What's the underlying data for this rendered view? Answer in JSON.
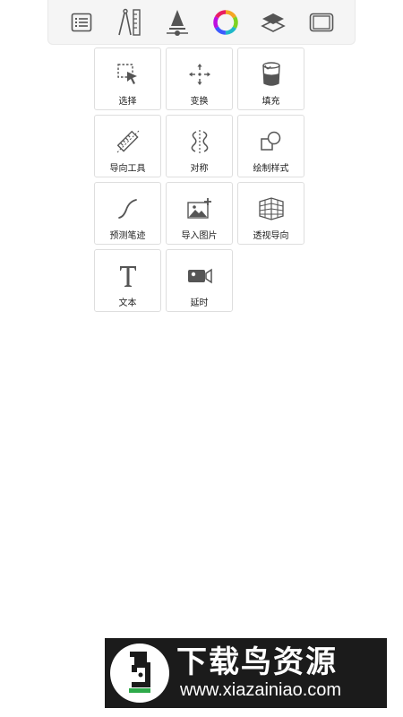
{
  "toolbar": {
    "items": [
      {
        "icon": "list-icon"
      },
      {
        "icon": "compass-ruler-icon"
      },
      {
        "icon": "brush-size-icon"
      },
      {
        "icon": "color-wheel-icon"
      },
      {
        "icon": "layers-icon"
      },
      {
        "icon": "canvas-frame-icon"
      }
    ]
  },
  "tools": [
    {
      "label": "选择",
      "icon": "selection-icon"
    },
    {
      "label": "变换",
      "icon": "move-icon"
    },
    {
      "label": "填充",
      "icon": "paint-bucket-icon"
    },
    {
      "label": "导向工具",
      "icon": "ruler-icon"
    },
    {
      "label": "对称",
      "icon": "symmetry-icon"
    },
    {
      "label": "绘制样式",
      "icon": "shapes-icon"
    },
    {
      "label": "预测笔迹",
      "icon": "stroke-curve-icon"
    },
    {
      "label": "导入图片",
      "icon": "import-image-icon"
    },
    {
      "label": "透视导向",
      "icon": "perspective-grid-icon"
    },
    {
      "label": "文本",
      "icon": "text-icon"
    },
    {
      "label": "延时",
      "icon": "video-camera-icon"
    }
  ],
  "watermark": {
    "brand": "下载鸟资源",
    "url": "www.xiazainiao.com",
    "icon": "xiazainiao-logo"
  }
}
